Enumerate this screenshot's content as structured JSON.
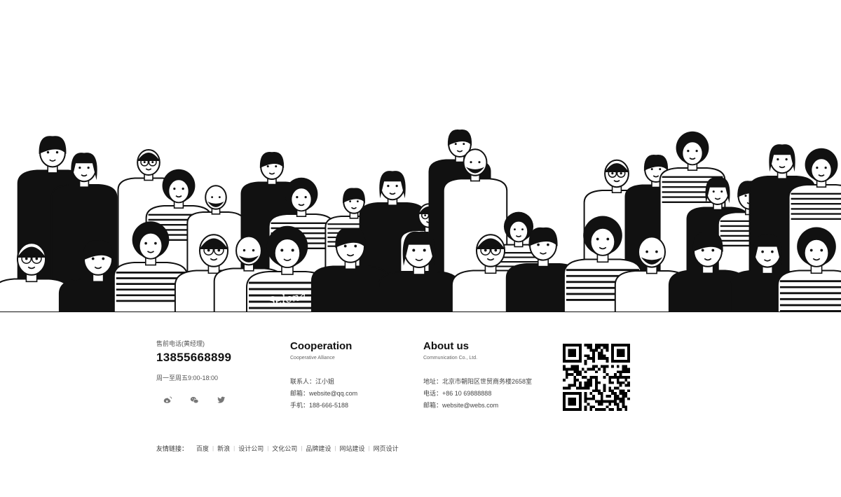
{
  "illustration": {
    "shirt_text": "Selena"
  },
  "contact": {
    "label": "售前电话(黄经理)",
    "phone": "13855668899",
    "hours": "周一至周五9:00-18:00",
    "socials": [
      {
        "icon": "weibo-icon"
      },
      {
        "icon": "wechat-icon"
      },
      {
        "icon": "twitter-icon"
      }
    ]
  },
  "cooperation": {
    "title": "Cooperation",
    "subtitle": "Cooperative Alliance",
    "lines": [
      "联系人：江小姐",
      "邮箱：website@qq.com",
      "手机：188-666-5188"
    ]
  },
  "about": {
    "title": "About us",
    "subtitle": "Communication Co., Ltd.",
    "lines": [
      "地址：北京市朝阳区世贸商务楼2658室",
      "电话：+86 10 69888888",
      "邮箱：website@webs.com"
    ]
  },
  "links": {
    "label": "友情链接：",
    "items": [
      "百度",
      "新浪",
      "设计公司",
      "文化公司",
      "品牌建设",
      "网站建设",
      "网页设计"
    ]
  },
  "colors": {
    "ink": "#111111",
    "background": "#ffffff"
  }
}
